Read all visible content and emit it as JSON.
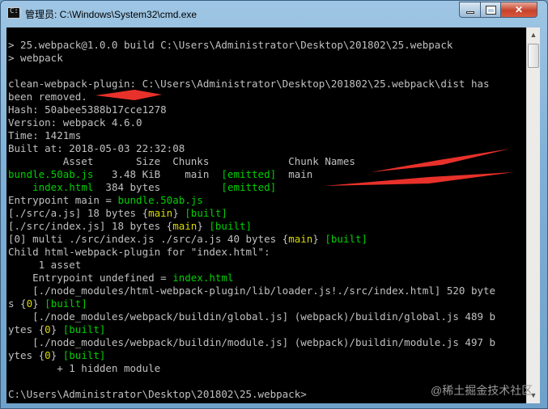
{
  "window": {
    "title": "管理员: C:\\Windows\\System32\\cmd.exe"
  },
  "controls": {
    "min_label": "minimize",
    "max_label": "maximize",
    "close_label": "✕"
  },
  "console": {
    "lines": [
      "> 25.webpack@1.0.0 build C:\\Users\\Administrator\\Desktop\\201802\\25.webpack",
      "> webpack",
      "",
      "clean-webpack-plugin: C:\\Users\\Administrator\\Desktop\\201802\\25.webpack\\dist has",
      "been removed.",
      "Hash: 50abee5388b17cce1278",
      "Version: webpack 4.6.0",
      "Time: 1421ms",
      "Built at: 2018-05-03 22:32:08",
      "         Asset       Size  Chunks             Chunk Names",
      "bundle.50ab.js   3.48 KiB    main  [emitted]  main",
      "    index.html  384 bytes          [emitted]",
      "Entrypoint main = bundle.50ab.js",
      "[./src/a.js] 18 bytes {main} [built]",
      "[./src/index.js] 18 bytes {main} [built]",
      "[0] multi ./src/index.js ./src/a.js 40 bytes {main} [built]",
      "Child html-webpack-plugin for \"index.html\":",
      "     1 asset",
      "    Entrypoint undefined = index.html",
      "    [./node_modules/html-webpack-plugin/lib/loader.js!./src/index.html] 520 byte",
      "s {0} [built]",
      "    [./node_modules/webpack/buildin/global.js] (webpack)/buildin/global.js 489 b",
      "ytes {0} [built]",
      "    [./node_modules/webpack/buildin/module.js] (webpack)/buildin/module.js 497 b",
      "ytes {0} [built]",
      "        + 1 hidden module",
      "",
      "C:\\Users\\Administrator\\Desktop\\201802\\25.webpack>"
    ]
  },
  "watermark": "@稀土掘金技术社区",
  "colors": {
    "green": "#00d000",
    "yellow": "#dada00",
    "text": "#c0c0c0",
    "arrow": "#e8312a"
  }
}
